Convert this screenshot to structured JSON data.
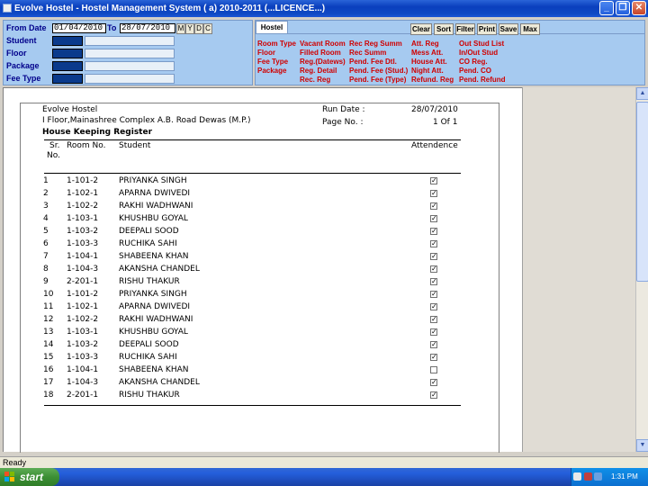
{
  "window": {
    "title": "Evolve Hostel - Hostel Management System ( a) 2010-2011 (...LICENCE...)",
    "min_label": "_",
    "restore_label": "❐",
    "close_label": "✕"
  },
  "filters": {
    "from_label": "From Date",
    "from_value": "01/04/2010",
    "to_label": "To",
    "to_value": "28/07/2010",
    "period_buttons": [
      "M",
      "Y",
      "D",
      "C"
    ],
    "fields": [
      "Student",
      "Floor",
      "Package",
      "Fee Type"
    ]
  },
  "hostel_panel": {
    "tab": "Hostel",
    "actions": [
      "Clear",
      "Sort",
      "Filter",
      "Print",
      "Save",
      "Max"
    ],
    "reports": {
      "col1": [
        "Room Type",
        "Floor",
        "Fee Type",
        "Package"
      ],
      "col2": [
        "Vacant Room",
        "Filled Room",
        "Reg.(Datews)",
        "Reg. Detail",
        "Rec. Reg"
      ],
      "col3": [
        "Rec Reg Summ",
        "Rec Summ",
        "Pend. Fee Dtl.",
        "Pend. Fee (Stud.)",
        "Pend. Fee (Type)"
      ],
      "col4": [
        "Att. Reg",
        "Mess Att.",
        "House Att.",
        "Night Att.",
        "Refund. Reg"
      ],
      "col5": [
        "Out Stud List",
        "In/Out Stud",
        "CO Reg.",
        "Pend. CO",
        "Pend. Refund"
      ]
    }
  },
  "report": {
    "org_name": "Evolve Hostel",
    "address": "I Floor,Mainashree Complex A.B. Road Dewas (M.P.)",
    "title": "House Keeping Register",
    "run_date_label": "Run Date :",
    "run_date": "28/07/2010",
    "page_label": "Page No. :",
    "page_value": "1 Of 1",
    "columns": {
      "sr": "Sr.",
      "no": "No.",
      "room": "Room No.",
      "student": "Student",
      "attendance": "Attendence"
    },
    "rows": [
      {
        "sr": "1",
        "room": "1-101-2",
        "student": "PRIYANKA SINGH",
        "present": true
      },
      {
        "sr": "2",
        "room": "1-102-1",
        "student": "APARNA DWIVEDI",
        "present": true
      },
      {
        "sr": "3",
        "room": "1-102-2",
        "student": "RAKHI WADHWANI",
        "present": true
      },
      {
        "sr": "4",
        "room": "1-103-1",
        "student": "KHUSHBU GOYAL",
        "present": true
      },
      {
        "sr": "5",
        "room": "1-103-2",
        "student": "DEEPALI SOOD",
        "present": true
      },
      {
        "sr": "6",
        "room": "1-103-3",
        "student": "RUCHIKA SAHI",
        "present": true
      },
      {
        "sr": "7",
        "room": "1-104-1",
        "student": "SHABEENA KHAN",
        "present": true
      },
      {
        "sr": "8",
        "room": "1-104-3",
        "student": "AKANSHA CHANDEL",
        "present": true
      },
      {
        "sr": "9",
        "room": "2-201-1",
        "student": "RISHU THAKUR",
        "present": true
      },
      {
        "sr": "10",
        "room": "1-101-2",
        "student": "PRIYANKA SINGH",
        "present": true
      },
      {
        "sr": "11",
        "room": "1-102-1",
        "student": "APARNA DWIVEDI",
        "present": true
      },
      {
        "sr": "12",
        "room": "1-102-2",
        "student": "RAKHI WADHWANI",
        "present": true
      },
      {
        "sr": "13",
        "room": "1-103-1",
        "student": "KHUSHBU GOYAL",
        "present": true
      },
      {
        "sr": "14",
        "room": "1-103-2",
        "student": "DEEPALI SOOD",
        "present": true
      },
      {
        "sr": "15",
        "room": "1-103-3",
        "student": "RUCHIKA SAHI",
        "present": true
      },
      {
        "sr": "16",
        "room": "1-104-1",
        "student": "SHABEENA KHAN",
        "present": false
      },
      {
        "sr": "17",
        "room": "1-104-3",
        "student": "AKANSHA CHANDEL",
        "present": true
      },
      {
        "sr": "18",
        "room": "2-201-1",
        "student": "RISHU THAKUR",
        "present": true
      }
    ]
  },
  "status": {
    "text": "Ready"
  },
  "taskbar": {
    "start_label": "start",
    "clock": "1:31 PM"
  },
  "colors": {
    "link_red": "#d00000",
    "panel_blue": "#a6caf0",
    "label_navy": "#00008b"
  }
}
